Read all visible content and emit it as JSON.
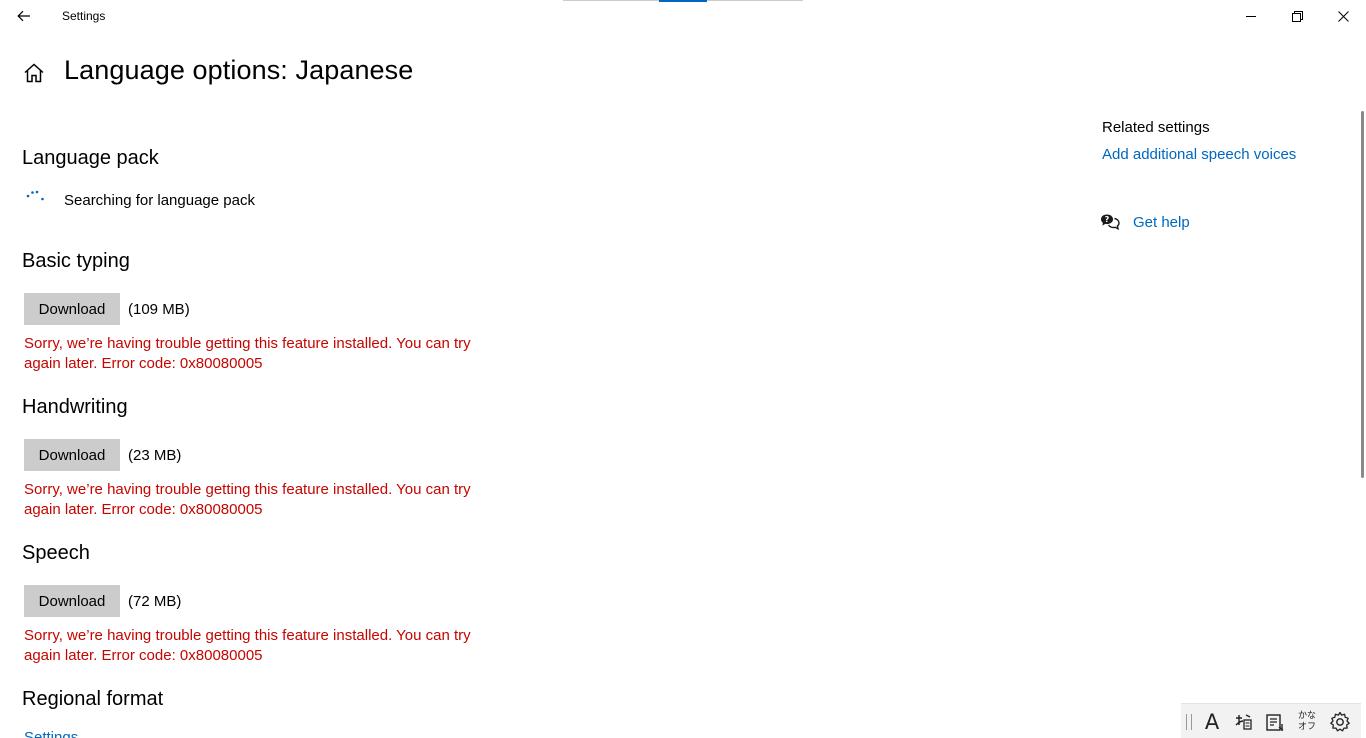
{
  "window": {
    "title": "Settings",
    "back_icon": "back-arrow-icon",
    "controls": [
      "minimize-icon",
      "restore-icon",
      "close-icon"
    ]
  },
  "header": {
    "home_icon": "home-icon",
    "title": "Language options: Japanese"
  },
  "language_pack": {
    "heading": "Language pack",
    "status": "Searching for language pack"
  },
  "features": [
    {
      "heading": "Basic typing",
      "button_label": "Download",
      "size": "(109 MB)",
      "error": "Sorry, we’re having trouble getting this feature installed. You can try again later. Error code: 0x80080005"
    },
    {
      "heading": "Handwriting",
      "button_label": "Download",
      "size": "(23 MB)",
      "error": "Sorry, we’re having trouble getting this feature installed. You can try again later. Error code: 0x80080005"
    },
    {
      "heading": "Speech",
      "button_label": "Download",
      "size": "(72 MB)",
      "error": "Sorry, we’re having trouble getting this feature installed. You can try again later. Error code: 0x80080005"
    }
  ],
  "regional_format": {
    "heading": "Regional format",
    "link": "Settings"
  },
  "related": {
    "heading": "Related settings",
    "link": "Add additional speech voices",
    "help_link": "Get help",
    "help_icon": "chat-help-icon"
  },
  "ime_toolbar": {
    "input_mode": "A",
    "kana_top": "かな",
    "kana_bottom": "オフ",
    "icons": [
      "input-mode-icon",
      "ime-pad-icon",
      "dictionary-icon",
      "kana-mode-icon",
      "ime-settings-gear-icon"
    ]
  },
  "colors": {
    "accent": "#0067c0",
    "error": "#c50500",
    "button_bg": "#cccccc"
  }
}
